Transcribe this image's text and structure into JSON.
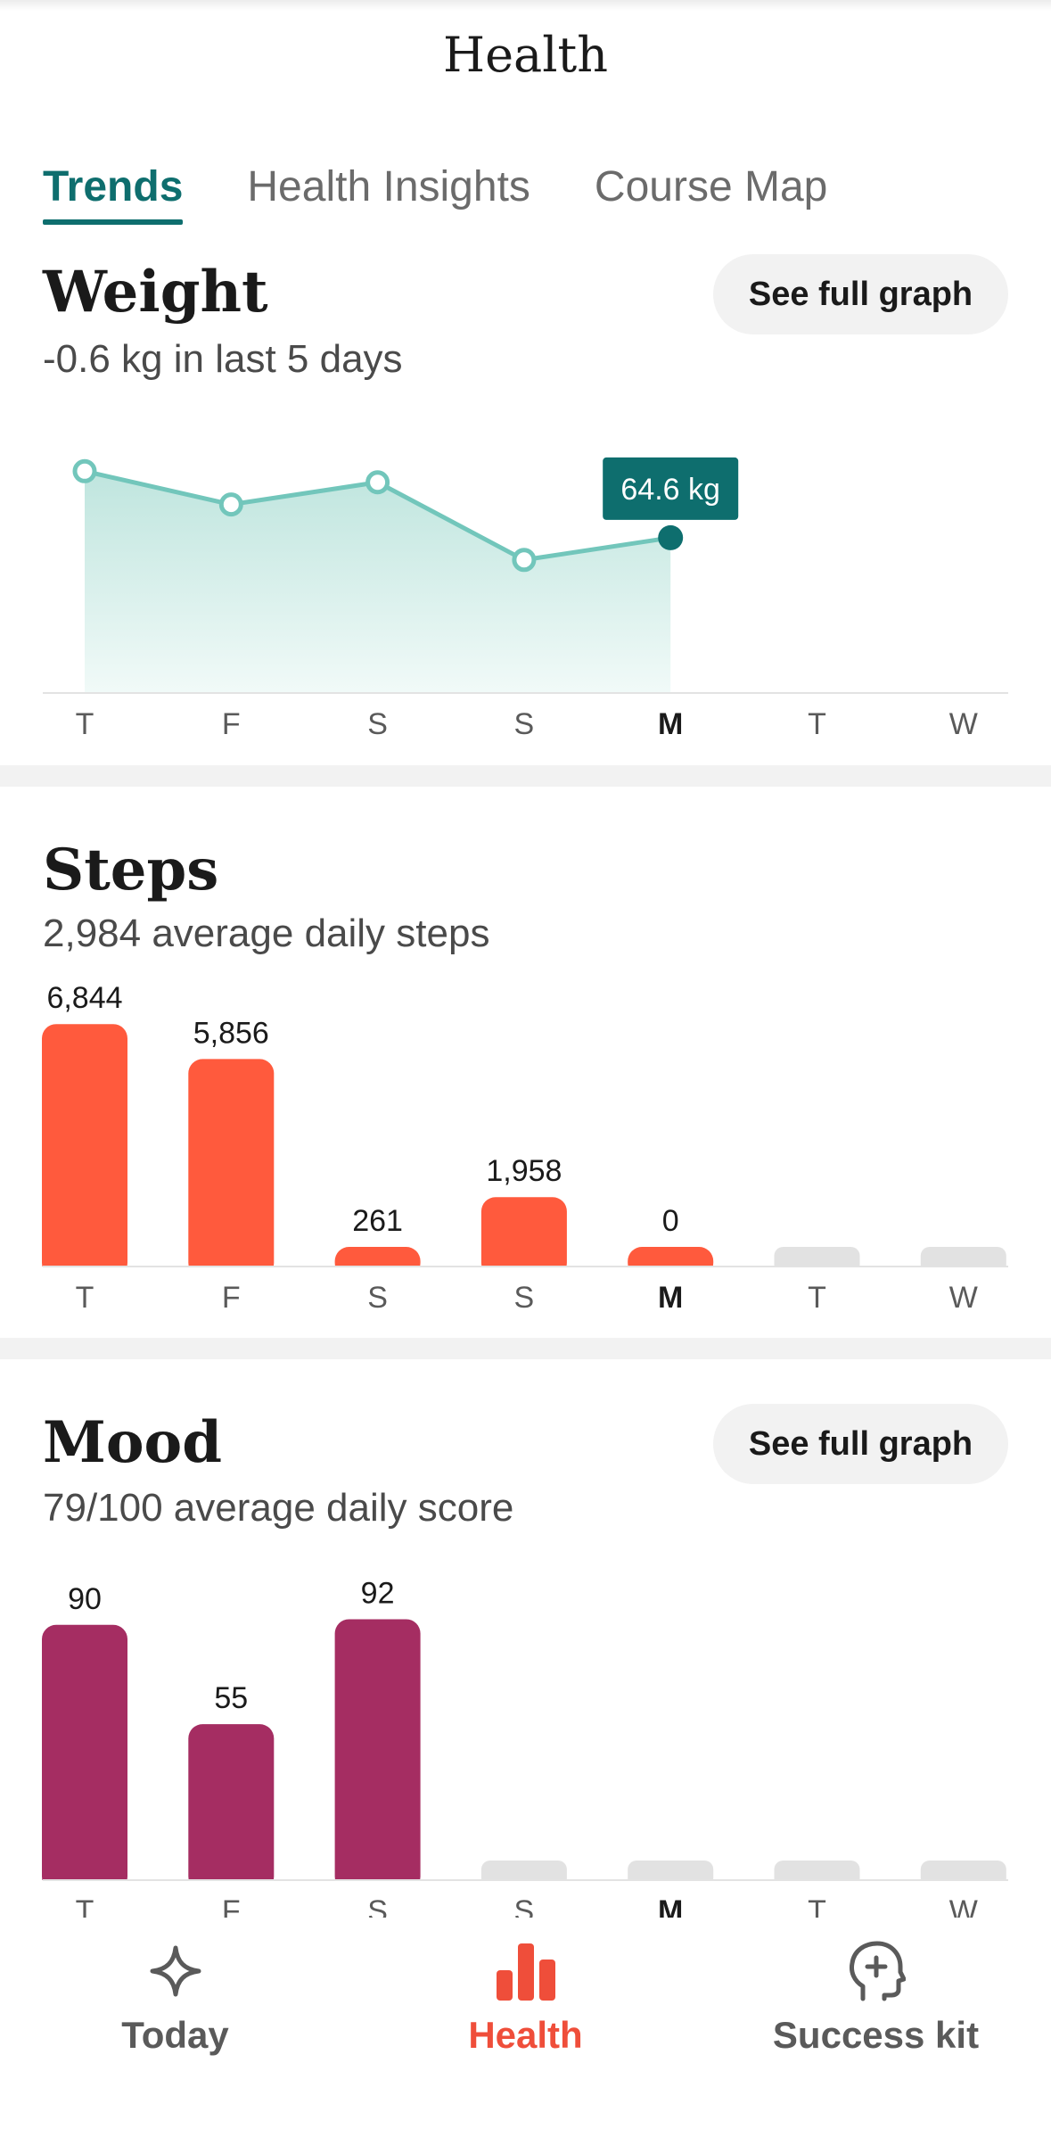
{
  "header": {
    "title": "Health"
  },
  "tabs": [
    {
      "label": "Trends",
      "active": true
    },
    {
      "label": "Health Insights",
      "active": false
    },
    {
      "label": "Course Map",
      "active": false
    }
  ],
  "weight": {
    "title": "Weight",
    "subtitle": "-0.6 kg in last 5 days",
    "button": "See full graph",
    "tooltip": "64.6 kg",
    "color": "#72c6bb",
    "highlight_color": "#0e6e6e"
  },
  "steps": {
    "title": "Steps",
    "subtitle": "2,984 average daily steps",
    "color": "#ff5a3d"
  },
  "mood": {
    "title": "Mood",
    "subtitle": "79/100 average daily score",
    "button": "See full graph",
    "color": "#a52d62"
  },
  "chart_data": [
    {
      "type": "line",
      "categories": [
        "T",
        "F",
        "S",
        "S",
        "M",
        "T",
        "W"
      ],
      "values": [
        65.2,
        64.9,
        65.1,
        64.4,
        64.6,
        null,
        null
      ],
      "highlight_index": 4,
      "highlight_label": "64.6 kg",
      "bold_category_index": 4,
      "ylim": [
        63.2,
        65.5
      ]
    },
    {
      "type": "bar",
      "categories": [
        "T",
        "F",
        "S",
        "S",
        "M",
        "T",
        "W"
      ],
      "values": [
        6844,
        5856,
        261,
        1958,
        0,
        null,
        null
      ],
      "data_labels": [
        "6,844",
        "5,856",
        "261",
        "1,958",
        "0",
        "",
        ""
      ],
      "bold_category_index": 4,
      "ylim": [
        0,
        7000
      ]
    },
    {
      "type": "bar",
      "categories": [
        "T",
        "F",
        "S",
        "S",
        "M",
        "T",
        "W"
      ],
      "values": [
        90,
        55,
        92,
        null,
        null,
        null,
        null
      ],
      "data_labels": [
        "90",
        "55",
        "92",
        "",
        "",
        "",
        ""
      ],
      "bold_category_index": 4,
      "ylim": [
        0,
        100
      ]
    }
  ],
  "bottom_nav": [
    {
      "label": "Today",
      "icon": "sparkle-icon",
      "active": false
    },
    {
      "label": "Health",
      "icon": "bar-chart-icon",
      "active": true
    },
    {
      "label": "Success kit",
      "icon": "head-plus-icon",
      "active": false
    }
  ]
}
